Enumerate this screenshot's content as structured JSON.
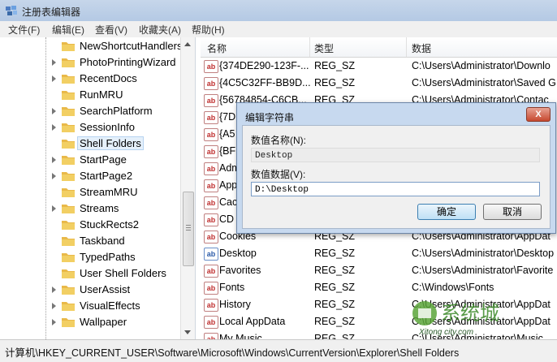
{
  "window": {
    "title": "注册表编辑器"
  },
  "menu": [
    "文件(F)",
    "编辑(E)",
    "查看(V)",
    "收藏夹(A)",
    "帮助(H)"
  ],
  "tree": {
    "items": [
      {
        "label": "NewShortcutHandlers",
        "expandable": false
      },
      {
        "label": "PhotoPrintingWizard",
        "expandable": true
      },
      {
        "label": "RecentDocs",
        "expandable": true
      },
      {
        "label": "RunMRU",
        "expandable": false
      },
      {
        "label": "SearchPlatform",
        "expandable": true
      },
      {
        "label": "SessionInfo",
        "expandable": true
      },
      {
        "label": "Shell Folders",
        "expandable": false,
        "selected": true
      },
      {
        "label": "StartPage",
        "expandable": true
      },
      {
        "label": "StartPage2",
        "expandable": true
      },
      {
        "label": "StreamMRU",
        "expandable": false
      },
      {
        "label": "Streams",
        "expandable": true
      },
      {
        "label": "StuckRects2",
        "expandable": false
      },
      {
        "label": "Taskband",
        "expandable": false
      },
      {
        "label": "TypedPaths",
        "expandable": false
      },
      {
        "label": "User Shell Folders",
        "expandable": false
      },
      {
        "label": "UserAssist",
        "expandable": true
      },
      {
        "label": "VisualEffects",
        "expandable": true
      },
      {
        "label": "Wallpaper",
        "expandable": true
      }
    ]
  },
  "list": {
    "headers": {
      "name": "名称",
      "type": "类型",
      "data": "数据"
    },
    "rows": [
      {
        "name": "{374DE290-123F-...",
        "type": "REG_SZ",
        "data": "C:\\Users\\Administrator\\Downlo"
      },
      {
        "name": "{4C5C32FF-BB9D...",
        "type": "REG_SZ",
        "data": "C:\\Users\\Administrator\\Saved G"
      },
      {
        "name": "{56784854-C6CB...",
        "type": "REG_SZ",
        "data": "C:\\Users\\Administrator\\Contac"
      },
      {
        "name": "{7D",
        "type": "",
        "data": ""
      },
      {
        "name": "{A5",
        "type": "",
        "data": ""
      },
      {
        "name": "{BF",
        "type": "",
        "data": ""
      },
      {
        "name": "Adm",
        "type": "",
        "data": ""
      },
      {
        "name": "App",
        "type": "",
        "data": ""
      },
      {
        "name": "Cac",
        "type": "",
        "data": ""
      },
      {
        "name": "CD",
        "type": "",
        "data": ""
      },
      {
        "name": "Cookies",
        "type": "REG_SZ",
        "data": "C:\\Users\\Administrator\\AppDat"
      },
      {
        "name": "Desktop",
        "type": "REG_SZ",
        "data": "C:\\Users\\Administrator\\Desktop",
        "blue": true
      },
      {
        "name": "Favorites",
        "type": "REG_SZ",
        "data": "C:\\Users\\Administrator\\Favorite"
      },
      {
        "name": "Fonts",
        "type": "REG_SZ",
        "data": "C:\\Windows\\Fonts"
      },
      {
        "name": "History",
        "type": "REG_SZ",
        "data": "C:\\Users\\Administrator\\AppDat"
      },
      {
        "name": "Local AppData",
        "type": "REG_SZ",
        "data": "C:\\Users\\Administrator\\AppDat"
      },
      {
        "name": "My Music",
        "type": "REG_SZ",
        "data": "C:\\Users\\Administrator\\Music"
      }
    ]
  },
  "dialog": {
    "title": "编辑字符串",
    "close": "X",
    "name_label": "数值名称(N):",
    "name_value": "Desktop",
    "data_label": "数值数据(V):",
    "data_value": "D:\\Desktop",
    "ok": "确定",
    "cancel": "取消"
  },
  "statusbar": {
    "path": "计算机\\HKEY_CURRENT_USER\\Software\\Microsoft\\Windows\\CurrentVersion\\Explorer\\Shell Folders"
  },
  "watermark": {
    "text": "Xitong city.com"
  },
  "colors": {
    "selection": "#e5f0fb",
    "folder": "#f2cf63",
    "titlebar": "#b4c9e4"
  }
}
